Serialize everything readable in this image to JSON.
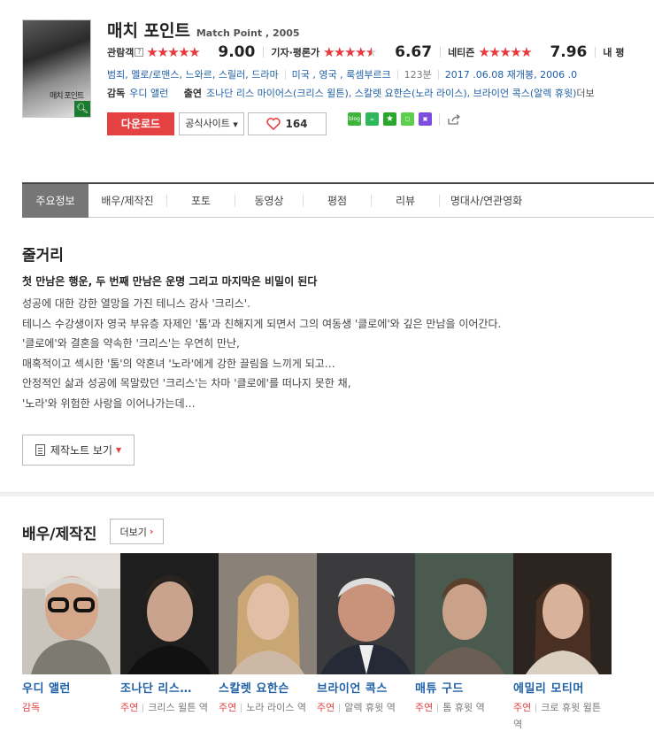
{
  "movie": {
    "title_ko": "매치 포인트",
    "title_en": "Match Point , 2005",
    "poster_title": "매치 포인트"
  },
  "ratings": [
    {
      "label": "관람객",
      "help": "?",
      "stars": 4.5,
      "score": "9.00"
    },
    {
      "label": "기자·평론가",
      "stars": 3.5,
      "score": "6.67"
    },
    {
      "label": "네티즌",
      "stars": 4.0,
      "score": "7.96"
    },
    {
      "label": "내 평"
    }
  ],
  "info": {
    "genres": "범죄, 멜로/로맨스, 느와르, 스릴러, 드라마",
    "countries": "미국 , 영국 , 룩셈부르크",
    "runtime": "123분",
    "release": "2017 .06.08 재개봉, 2006 .0"
  },
  "crew": {
    "director_label": "감독",
    "director": "우디 앨런",
    "cast_label": "출연",
    "actors": "조나단 리스 마이어스(크리스 윌튼), 스칼렛 요한슨(노라 라이스), 브라이언 콕스(알렉 휴윗)",
    "more": "더보"
  },
  "buttons": {
    "download": "다운로드",
    "official_site": "공식사이트",
    "like_count": "164",
    "blog": "blog"
  },
  "tabs": [
    "주요정보",
    "배우/제작진",
    "포토",
    "동영상",
    "평점",
    "리뷰",
    "명대사/연관영화"
  ],
  "synopsis": {
    "heading": "줄거리",
    "headline": "첫 만남은 행운, 두 번째 만남은 운명 그리고 마지막은 비밀이 된다",
    "lines": [
      "성공에 대한 강한 열망을 가진 테니스 강사 '크리스'.",
      " 테니스 수강생이자 영국 부유층 자제인 '톰'과 친해지게 되면서 그의 여동생 '클로에'와 깊은 만남을 이어간다.",
      " '클로에'와 결혼을 약속한 '크리스'는 우연히 만난,",
      " 매혹적이고 섹시한 '톰'의 약혼녀 '노라'에게 강한 끌림을 느끼게 되고…",
      " 안정적인 삶과 성공에 목말랐던 '크리스'는 차마 '클로에'를 떠나지 못한 채,",
      " '노라'와 위험한 사랑을 이어나가는데…"
    ],
    "note_button": "제작노트 보기"
  },
  "cast_section": {
    "heading": "배우/제작진",
    "more": "더보기",
    "members": [
      {
        "name": "우디 앨런",
        "type": "감독",
        "role": ""
      },
      {
        "name": "조나단 리스…",
        "type": "주연",
        "role": "크리스 윌튼 역"
      },
      {
        "name": "스칼렛 요한슨",
        "type": "주연",
        "role": "노라 라이스 역"
      },
      {
        "name": "브라이언 콕스",
        "type": "주연",
        "role": "알렉 휴윗 역"
      },
      {
        "name": "매튜 구드",
        "type": "주연",
        "role": "톰 휴윗 역"
      },
      {
        "name": "에밀리 모티머",
        "type": "주연",
        "role": "크로 휴윗 윌튼 역"
      }
    ]
  }
}
